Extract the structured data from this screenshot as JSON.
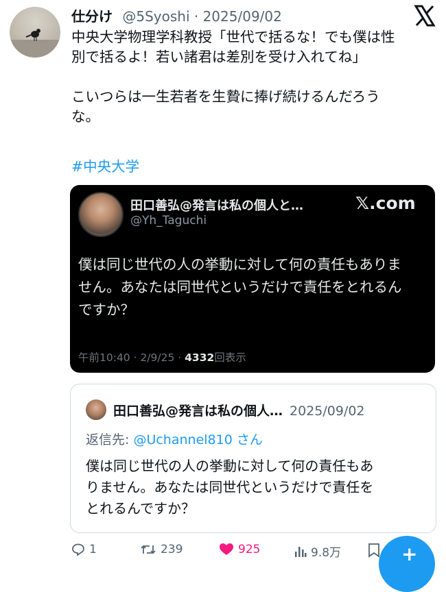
{
  "tweet": {
    "author_name": "仕分け",
    "meta": "@5Syoshi · 2025/09/02",
    "text": "中央大学物理学科教授「世代で括るな！でも僕は性\n別で括るよ！若い諸君は差別を受け入れてね」\n\nこいつらは一生若者を生贄に捧げ続けるんだろう\nな。",
    "hashtag": "#中央大学"
  },
  "embed": {
    "name": "田口善弘@発言は私の個人と…",
    "handle": "@Yh_Taguchi",
    "site": "𝕏.com",
    "text": "僕は同じ世代の人の挙動に対して何の責任もありま\nせん。あなたは同世代というだけで責任をとれるん\nですか？",
    "footer_time": "午前10:40 · 2/9/25 · ",
    "footer_views": "4332",
    "footer_views_label": "回表示"
  },
  "quote": {
    "name": "田口善弘@発言は私の個人…",
    "date": "2025/09/02",
    "reply_prefix": "返信先: ",
    "reply_mention": "@Uchannel810 さん",
    "text": "僕は同じ世代の人の挙動に対して何の責任もあ\nりません。あなたは同世代というだけで責任を\nとれるんですか？"
  },
  "actions": {
    "replies": "1",
    "retweets": "239",
    "likes": "925",
    "views": "9.8万"
  },
  "fab": {
    "label": "+"
  },
  "icons": {
    "x_logo": "x-logo-icon",
    "reply": "reply-icon",
    "retweet": "retweet-icon",
    "like": "heart-icon",
    "views": "views-icon",
    "bookmark": "bookmark-icon"
  },
  "colors": {
    "accent": "#1d9bf0",
    "like": "#f91880",
    "muted": "#536471",
    "embed_bg": "#000000"
  }
}
